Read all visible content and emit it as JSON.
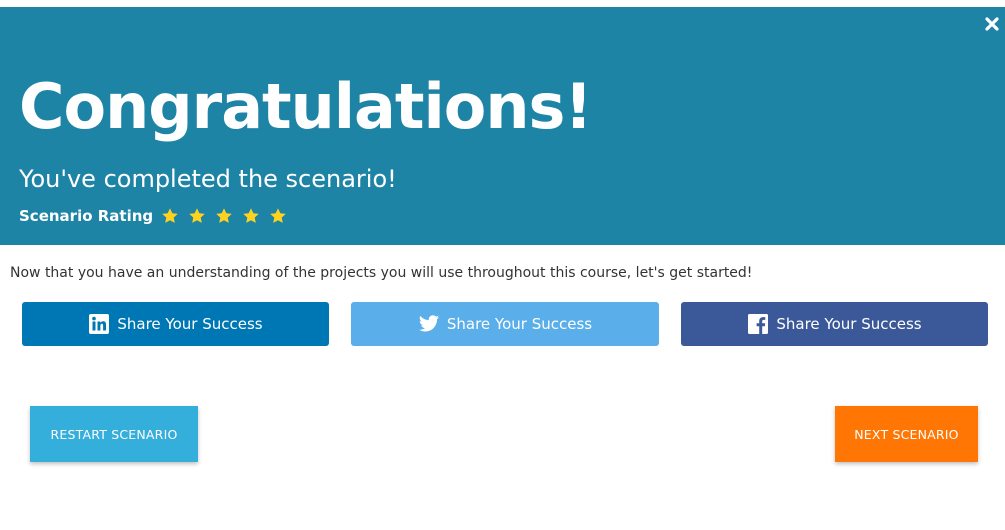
{
  "header": {
    "title": "Congratulations!",
    "subtitle": "You've completed the scenario!",
    "rating_label": "Scenario Rating",
    "rating": {
      "value": 5,
      "max": 5
    },
    "close_icon": "close-icon",
    "background_color": "#1e84a6",
    "star_color": "#ffd21f"
  },
  "main": {
    "message": "Now that you have an understanding of the projects you will use throughout this course, let's get started!"
  },
  "share_buttons": [
    {
      "network": "linkedin",
      "icon": "linkedin-icon",
      "label": "Share Your Success",
      "color": "#0077b5"
    },
    {
      "network": "twitter",
      "icon": "twitter-icon",
      "label": "Share Your Success",
      "color": "#5aaee9"
    },
    {
      "network": "facebook",
      "icon": "facebook-icon",
      "label": "Share Your Success",
      "color": "#3b5998"
    }
  ],
  "actions": {
    "restart_label": "RESTART SCENARIO",
    "restart_color": "#34aedb",
    "next_label": "NEXT SCENARIO",
    "next_color": "#ff7605"
  }
}
